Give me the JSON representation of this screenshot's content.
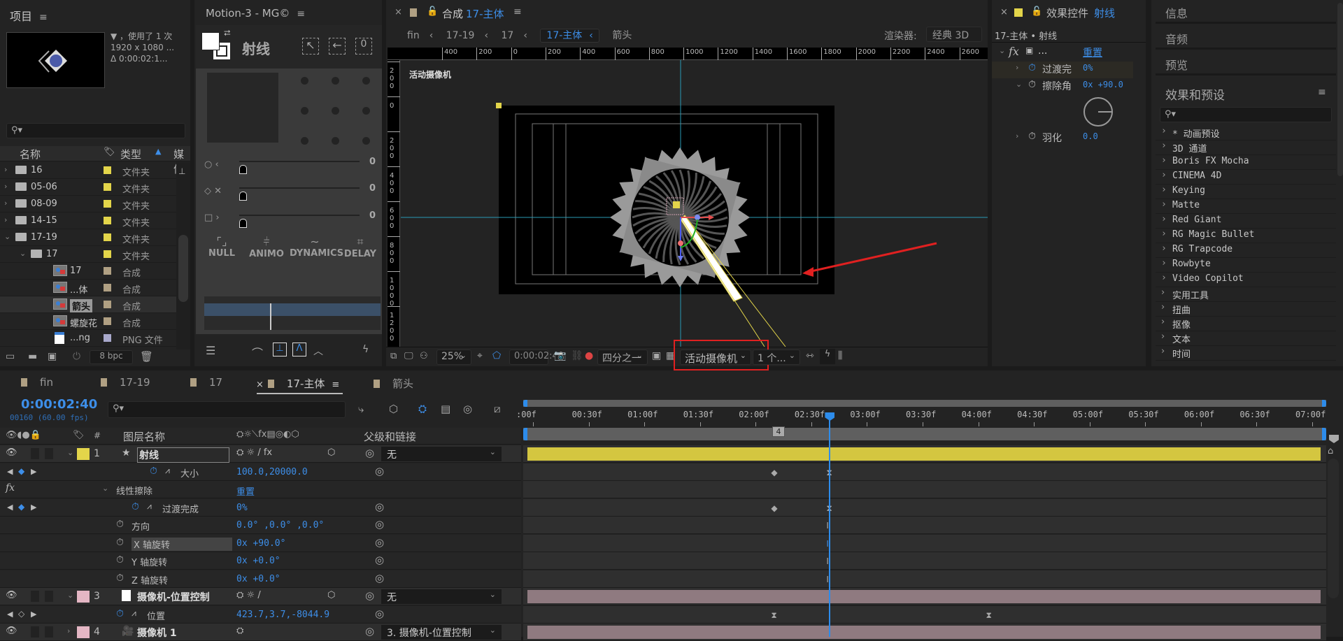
{
  "project": {
    "title": "项目",
    "info_line1": "▼ ，使用了 1 次",
    "info_line2": "1920 x 1080 ...",
    "info_line3": "Δ 0:00:02:1...",
    "search_placeholder": "",
    "columns": {
      "name": "名称",
      "type": "类型",
      "media": "媒体"
    },
    "items": [
      {
        "name": "16",
        "kind": "folder",
        "type": "文件夹",
        "color": "#e3d54a",
        "indent": 0,
        "expanded": false
      },
      {
        "name": "05-06",
        "kind": "folder",
        "type": "文件夹",
        "color": "#e3d54a",
        "indent": 0,
        "expanded": false
      },
      {
        "name": "08-09",
        "kind": "folder",
        "type": "文件夹",
        "color": "#e3d54a",
        "indent": 0,
        "expanded": false
      },
      {
        "name": "14-15",
        "kind": "folder",
        "type": "文件夹",
        "color": "#e3d54a",
        "indent": 0,
        "expanded": false
      },
      {
        "name": "17-19",
        "kind": "folder",
        "type": "文件夹",
        "color": "#e3d54a",
        "indent": 0,
        "expanded": true
      },
      {
        "name": "17",
        "kind": "folder",
        "type": "文件夹",
        "color": "#e3d54a",
        "indent": 1,
        "expanded": true
      },
      {
        "name": "17",
        "kind": "comp",
        "type": "合成",
        "color": "#b0a083",
        "indent": 2
      },
      {
        "name": "...体",
        "kind": "comp",
        "type": "合成",
        "color": "#b0a083",
        "indent": 2
      },
      {
        "name": "箭头",
        "kind": "comp",
        "type": "合成",
        "color": "#b0a083",
        "indent": 2,
        "selected": true
      },
      {
        "name": "螺旋花",
        "kind": "comp",
        "type": "合成",
        "color": "#b0a083",
        "indent": 2
      },
      {
        "name": "...ng",
        "kind": "png",
        "type": "PNG 文件",
        "color": "#a9a9cc",
        "indent": 2
      }
    ],
    "bpc": "8 bpc"
  },
  "motion": {
    "title": "Motion-3 - MG©",
    "layer_name": "射线",
    "slider_values": [
      "0",
      "0",
      "0"
    ],
    "buttons": [
      "NULL",
      "ANIMO",
      "DYNAMICS",
      "DELAY"
    ]
  },
  "comp": {
    "tab_prefix": "合成",
    "tab_name": "17-主体",
    "breadcrumbs": [
      "fin",
      "17-19",
      "17",
      "17-主体",
      "箭头"
    ],
    "renderer_label": "渲染器:",
    "renderer_value": "经典 3D",
    "viewer_label": "活动摄像机",
    "hruler_labels": [
      "400",
      "200",
      "0",
      "200",
      "400",
      "600",
      "800",
      "1000",
      "1200",
      "1400",
      "1600",
      "1800",
      "2000",
      "2200",
      "2400",
      "2600"
    ],
    "vruler_labels": [
      "200",
      "0",
      "200",
      "400",
      "600",
      "800",
      "1000",
      "1200"
    ],
    "zoom": "25%",
    "timecode": "0:00:02:40",
    "resolution": "四分之一",
    "camera": "活动摄像机",
    "views": "1 个...",
    "highlight_color": "#e02020"
  },
  "effect_controls": {
    "title_prefix": "效果控件",
    "title_layer": "射线",
    "subtitle": "17-主体 • 射线",
    "effect_name": "...",
    "reset": "重置",
    "props": [
      {
        "name": "过渡完",
        "value": "0%"
      },
      {
        "name": "擦除角",
        "value": "0x +90.0"
      },
      {
        "name": "羽化",
        "value": "0.0"
      }
    ]
  },
  "right_panel": {
    "tabs": [
      "信息",
      "音频",
      "预览"
    ],
    "effects_title": "效果和预设",
    "effects": [
      "* 动画预设",
      "3D 通道",
      "Boris FX Mocha",
      "CINEMA 4D",
      "Keying",
      "Matte",
      "Red Giant",
      "RG Magic Bullet",
      "RG Trapcode",
      "Rowbyte",
      "Video Copilot",
      "实用工具",
      "扭曲",
      "抠像",
      "文本",
      "时间"
    ]
  },
  "timeline": {
    "tabs": [
      {
        "label": "fin",
        "active": false
      },
      {
        "label": "17-19",
        "active": false
      },
      {
        "label": "17",
        "active": false
      },
      {
        "label": "17-主体",
        "active": true
      },
      {
        "label": "箭头",
        "active": false
      }
    ],
    "timecode": "0:00:02:40",
    "frame_info": "00160 (60.00 fps)",
    "col_layer_name": "图层名称",
    "col_parent": "父级和链接",
    "ruler": [
      ":00f",
      "00:30f",
      "01:00f",
      "01:30f",
      "02:00f",
      "02:30f",
      "03:00f",
      "03:30f",
      "04:00f",
      "04:30f",
      "05:00f",
      "05:30f",
      "06:00f",
      "06:30f",
      "07:00f"
    ],
    "playhead_seconds": 2.667,
    "duration_seconds": 7.0,
    "marker_label": "4",
    "rows": [
      {
        "type": "layer",
        "num": "1",
        "name": "射线",
        "color": "#e3d54a",
        "parent": "无",
        "bar": "#d4c640"
      },
      {
        "type": "prop",
        "name": "大小",
        "value": "100.0,20000.0",
        "keys": [
          2.17,
          2.667
        ]
      },
      {
        "type": "effect",
        "name": "线性擦除",
        "value": "重置"
      },
      {
        "type": "prop",
        "name": "过渡完成",
        "value": "0%",
        "keys": [
          2.17,
          2.667
        ]
      },
      {
        "type": "prop",
        "name": "方向",
        "value": "0.0° ,0.0° ,0.0°",
        "keys": [
          2.667
        ]
      },
      {
        "type": "prop",
        "name": "X 轴旋转",
        "value": "0x +90.0°",
        "keys": [
          2.667
        ]
      },
      {
        "type": "prop",
        "name": "Y 轴旋转",
        "value": "0x +0.0°",
        "keys": [
          2.667
        ]
      },
      {
        "type": "prop",
        "name": "Z 轴旋转",
        "value": "0x +0.0°",
        "keys": [
          2.667
        ]
      },
      {
        "type": "layer",
        "num": "3",
        "name": "摄像机-位置控制",
        "color": "#e4b6c4",
        "parent": "无",
        "bar": "#8f7a80"
      },
      {
        "type": "prop",
        "name": "位置",
        "value": "423.7,3.7,-8044.9",
        "keys": [
          2.17,
          4.1
        ]
      },
      {
        "type": "layer",
        "num": "4",
        "name": "摄像机 1",
        "color": "#e4b6c4",
        "parent": "3. 摄像机-位置控制",
        "bar": "#8f7a80"
      }
    ]
  }
}
